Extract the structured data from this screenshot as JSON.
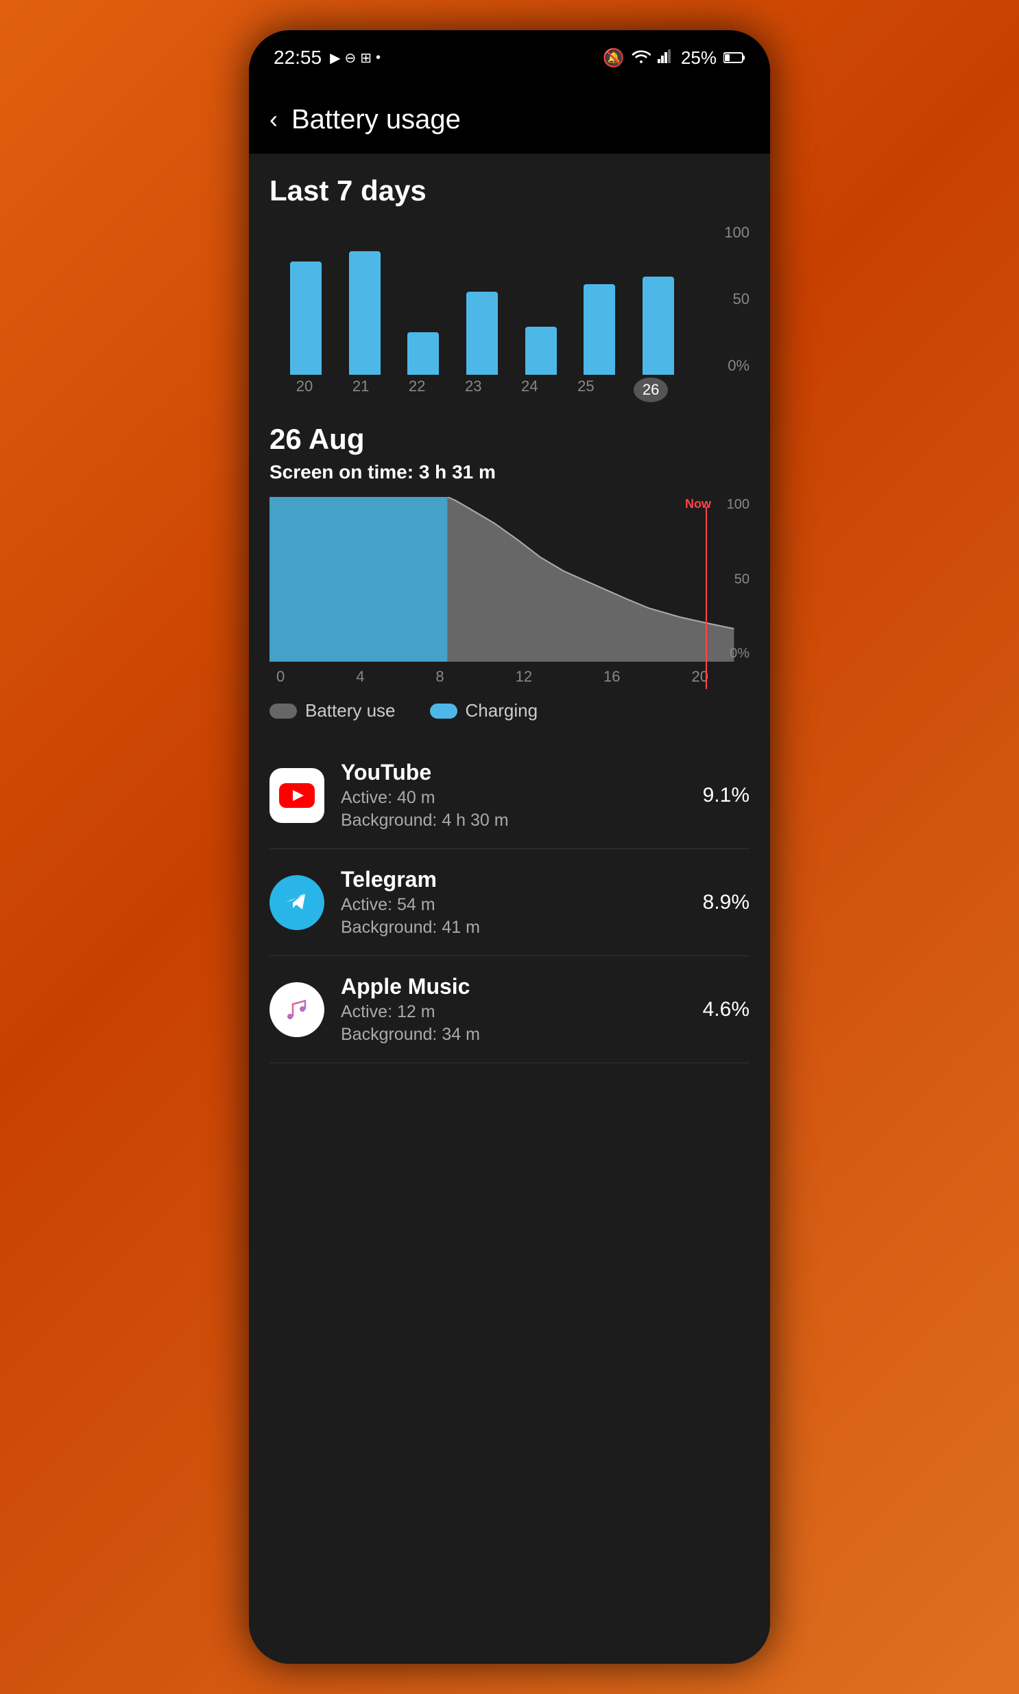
{
  "status_bar": {
    "time": "22:55",
    "battery_percent": "25%",
    "icons_left": [
      "▶",
      "⊖",
      "⊞",
      "•"
    ],
    "icons_right": [
      "🔇",
      "📶",
      "📶",
      "25%",
      "🔋"
    ]
  },
  "header": {
    "back_label": "‹",
    "title": "Battery usage"
  },
  "weekly_chart": {
    "title": "Last 7 days",
    "y_labels": [
      "100",
      "50",
      "0%"
    ],
    "x_labels": [
      "20",
      "21",
      "22",
      "23",
      "24",
      "25",
      "26"
    ],
    "bars": [
      {
        "day": "20",
        "height_pct": 75
      },
      {
        "day": "21",
        "height_pct": 82
      },
      {
        "day": "22",
        "height_pct": 28
      },
      {
        "day": "23",
        "height_pct": 55
      },
      {
        "day": "24",
        "height_pct": 32
      },
      {
        "day": "25",
        "height_pct": 60
      },
      {
        "day": "26",
        "height_pct": 65,
        "active": true
      }
    ]
  },
  "daily_detail": {
    "date": "26 Aug",
    "screen_time_label": "Screen on time: 3 h 31 m",
    "x_labels": [
      "0",
      "4",
      "8",
      "12",
      "16",
      "20"
    ],
    "y_labels": [
      "100",
      "50",
      "0%"
    ],
    "now_label": "Now"
  },
  "legend": {
    "battery_use": "Battery use",
    "charging": "Charging"
  },
  "apps": [
    {
      "name": "YouTube",
      "active": "Active: 40 m",
      "background": "Background: 4 h 30 m",
      "percent": "9.1%",
      "icon_type": "youtube"
    },
    {
      "name": "Telegram",
      "active": "Active: 54 m",
      "background": "Background: 41 m",
      "percent": "8.9%",
      "icon_type": "telegram"
    },
    {
      "name": "Apple Music",
      "active": "Active: 12 m",
      "background": "Background: 34 m",
      "percent": "4.6%",
      "icon_type": "apple_music"
    }
  ]
}
